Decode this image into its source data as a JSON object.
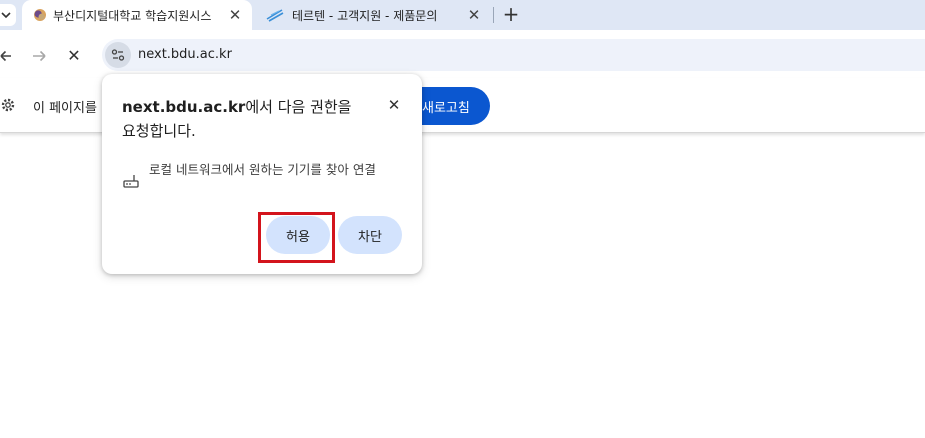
{
  "tabs": [
    {
      "title": "부산디지털대학교 학습지원시스",
      "close": "✕"
    },
    {
      "title": "테르텐 - 고객지원 - 제품문의",
      "close": "✕"
    }
  ],
  "new_tab": "+",
  "toolbar": {
    "url": "next.bdu.ac.kr",
    "stop": "✕"
  },
  "infobar": {
    "message": "이 페이지를",
    "reload_button": "새로고침"
  },
  "popup": {
    "origin": "next.bdu.ac.kr",
    "title_rest": "에서 다음 권한을",
    "title_line2": "요청합니다.",
    "close": "✕",
    "permission": "로컬 네트워크에서 원하는 기기를 찾아 연결",
    "allow_button": "허용",
    "block_button": "차단"
  },
  "colors": {
    "accent": "#0b57d0",
    "highlight": "#d3141c",
    "pill": "#d3e3fd"
  }
}
